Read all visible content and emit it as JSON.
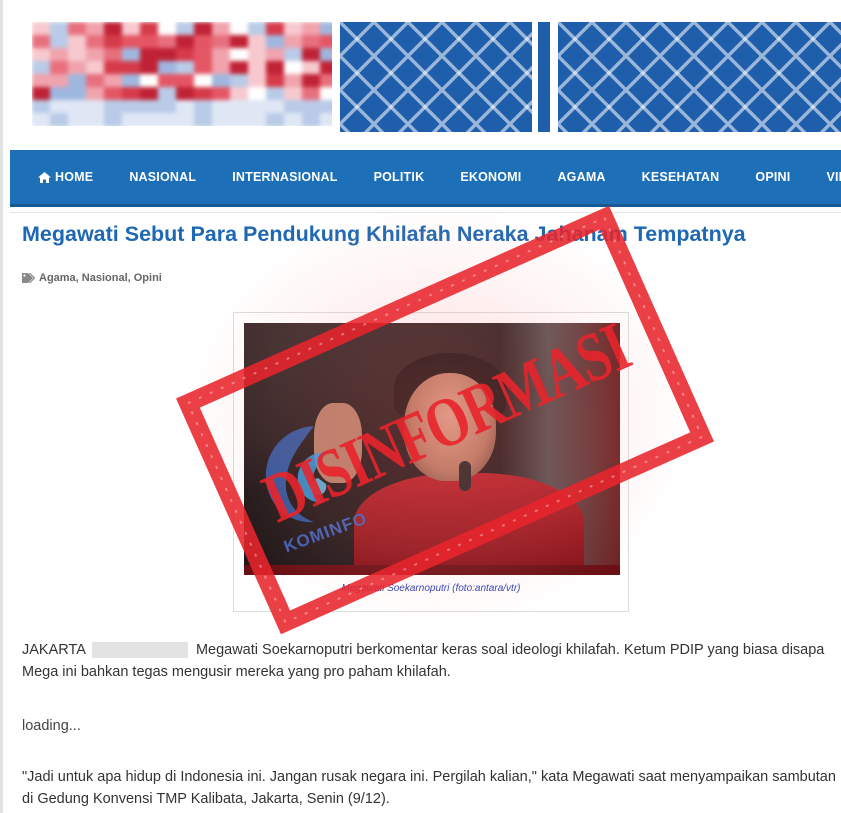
{
  "nav": {
    "items": [
      {
        "label": "HOME",
        "icon": "home-icon"
      },
      {
        "label": "NASIONAL"
      },
      {
        "label": "INTERNASIONAL"
      },
      {
        "label": "POLITIK"
      },
      {
        "label": "EKONOMI"
      },
      {
        "label": "AGAMA"
      },
      {
        "label": "KESEHATAN"
      },
      {
        "label": "OPINI"
      },
      {
        "label": "VID"
      }
    ]
  },
  "article": {
    "title": "Megawati Sebut Para Pendukung Khilafah Neraka Jahanam Tempatnya",
    "tags": "Agama, Nasional, Opini",
    "caption": "Megawati Soekarnoputri (foto:antara/vtr)",
    "p1_location": "JAKARTA",
    "p1_text": "Megawati Soekarnoputri berkomentar keras soal ideologi khilafah. Ketum PDIP yang biasa disapa Mega ini bahkan tegas mengusir mereka yang pro paham khilafah.",
    "loading": "loading...",
    "p2_text": "\"Jadi untuk apa hidup di Indonesia ini. Jangan rusak negara ini. Pergilah kalian,\" kata Megawati saat menyampaikan sambutan di Gedung Konvensi TMP Kalibata, Jakarta, Senin (9/12)."
  },
  "stamp": {
    "text": "DISINFORMASI",
    "logo_text": "KOMINFO"
  },
  "colors": {
    "nav": "#1d70b8",
    "title": "#1e68b3",
    "stamp": "#e8242c"
  }
}
